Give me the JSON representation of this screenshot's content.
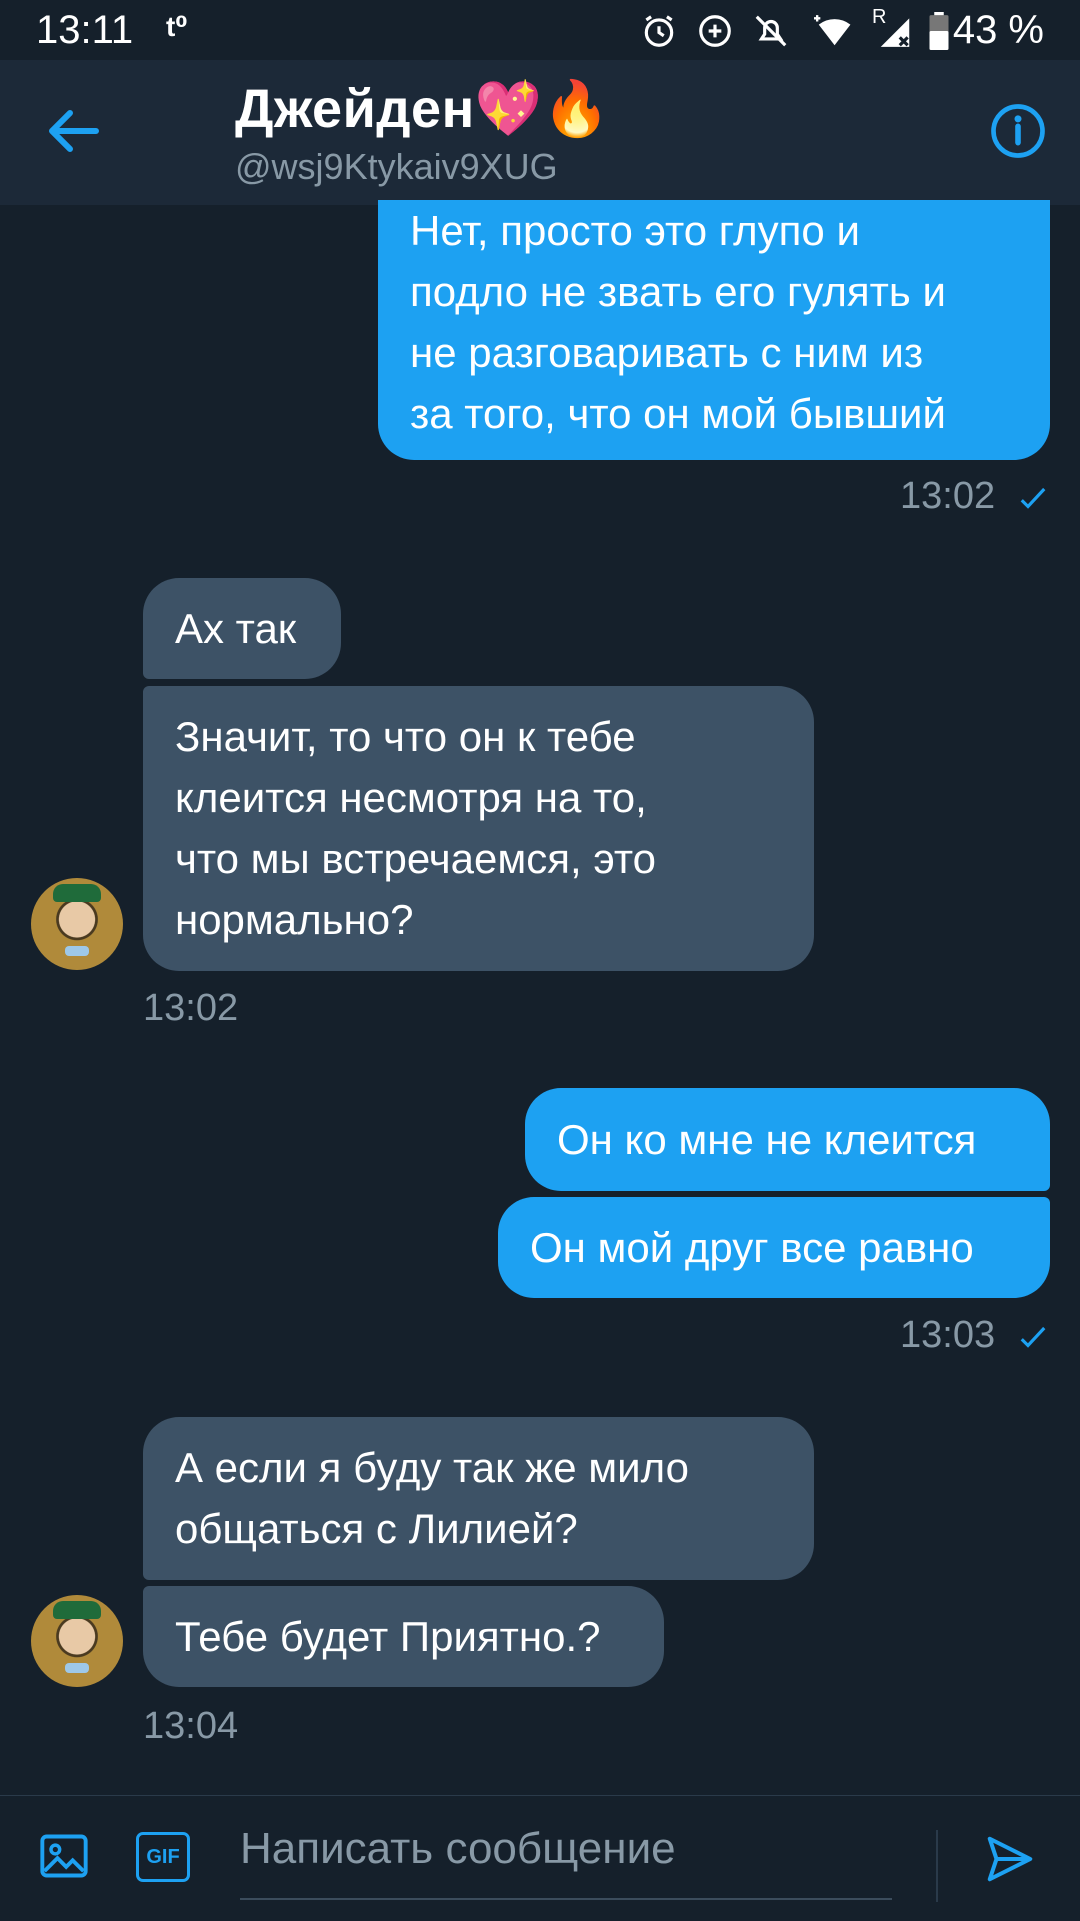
{
  "status_bar": {
    "time": "13:11",
    "notification_glyph": "t⁰",
    "icons": [
      "alarm-icon",
      "data-saver-icon",
      "do-not-disturb-icon",
      "wifi-icon",
      "signal-icon",
      "battery-icon"
    ],
    "roaming_label": "R",
    "battery_percent": "43 %"
  },
  "header": {
    "name": "Джейден",
    "emoji": "💖🔥",
    "handle": "@wsj9Ktykaiv9XUG"
  },
  "messages": [
    {
      "side": "out",
      "lines": [
        "Нет, просто это глупо и",
        "подло не звать его гулять и",
        "не разговаривать с ним из",
        "за того, что он мой бывший"
      ]
    },
    {
      "side": "out",
      "timestamp": "13:02",
      "seen": true
    },
    {
      "side": "in",
      "lines": [
        "Ах так"
      ]
    },
    {
      "side": "in",
      "lines": [
        "Значит, то что он к тебе",
        "клеится несмотря на то,",
        "что мы встречаемся, это",
        "нормально?"
      ]
    },
    {
      "side": "in",
      "timestamp": "13:02"
    },
    {
      "side": "out",
      "lines": [
        "Он ко мне не клеится"
      ]
    },
    {
      "side": "out",
      "lines": [
        "Он мой друг все равно"
      ]
    },
    {
      "side": "out",
      "timestamp": "13:03",
      "seen": true
    },
    {
      "side": "in",
      "lines": [
        "А если я буду так же мило",
        "общаться с Лилией?"
      ]
    },
    {
      "side": "in",
      "lines": [
        "Тебе будет Приятно.?"
      ]
    },
    {
      "side": "in",
      "timestamp": "13:04"
    }
  ],
  "composer": {
    "placeholder": "Написать сообщение",
    "gif_label": "GIF"
  },
  "colors": {
    "background": "#15202b",
    "header": "#1c2938",
    "outgoing_bubble": "#1da1f2",
    "incoming_bubble": "#3d5266",
    "accent": "#1da1f2",
    "secondary_text": "#8899a6"
  }
}
